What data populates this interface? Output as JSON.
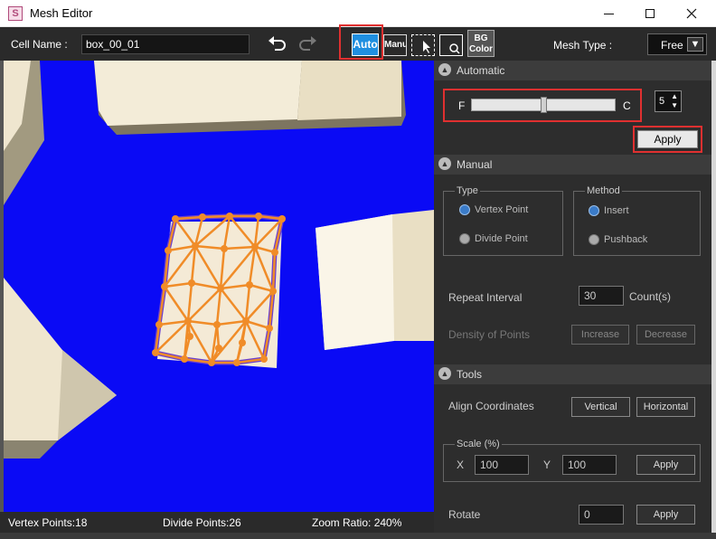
{
  "window": {
    "title": "Mesh Editor",
    "app_icon": "S"
  },
  "toolbar": {
    "cell_name_label": "Cell Name :",
    "cell_name_value": "box_00_01",
    "auto_tool": "Auto",
    "manual_tool": "Manual",
    "bg_color_line1": "BG",
    "bg_color_line2": "Color",
    "mesh_type_label": "Mesh Type :",
    "mesh_type_value": "Free"
  },
  "status": {
    "vertex_points": "Vertex Points:18",
    "divide_points": "Divide Points:26",
    "zoom_ratio": "Zoom Ratio: 240%"
  },
  "panel": {
    "automatic": {
      "header": "Automatic",
      "slider_left": "F",
      "slider_right": "C",
      "slider_level": 0.5,
      "density_value": "5",
      "apply_label": "Apply"
    },
    "manual": {
      "header": "Manual",
      "type_legend": "Type",
      "type_options": [
        "Vertex Point",
        "Divide Point"
      ],
      "method_legend": "Method",
      "method_options": [
        "Insert",
        "Pushback"
      ],
      "repeat_interval_label": "Repeat Interval",
      "repeat_interval_value": "30",
      "count_label": "Count(s)",
      "density_label": "Density of Points",
      "increase_label": "Increase",
      "decrease_label": "Decrease"
    },
    "tools": {
      "header": "Tools",
      "align_label": "Align Coordinates",
      "vertical_label": "Vertical",
      "horizontal_label": "Horizontal",
      "scale_legend": "Scale (%)",
      "x_label": "X",
      "x_value": "100",
      "y_label": "Y",
      "y_value": "100",
      "scale_apply_label": "Apply",
      "rotate_label": "Rotate",
      "rotate_value": "0",
      "rotate_apply_label": "Apply"
    }
  },
  "colors": {
    "canvas_bg": "#0a0af5",
    "highlight": "#e03030",
    "mesh": "#f08c28",
    "panel_bg": "#2d2d2d"
  }
}
